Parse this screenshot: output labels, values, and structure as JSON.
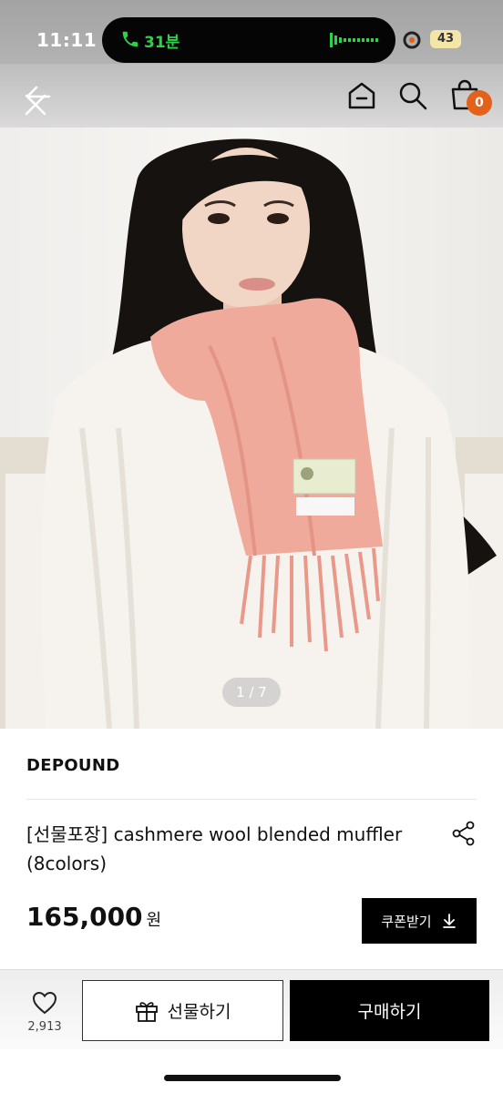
{
  "status_bar": {
    "time": "11:11",
    "call_duration": "31분",
    "battery": "43"
  },
  "nav": {
    "cart_count": "0",
    "icons": [
      "back-arrow-icon",
      "close-icon",
      "home-icon",
      "search-icon",
      "shopping-bag-icon"
    ]
  },
  "gallery": {
    "pager": "1 / 7",
    "current": 1,
    "total": 7
  },
  "product": {
    "brand": "DEPOUND",
    "title": "[선물포장] cashmere wool blended muffler (8colors)",
    "price": "165,000",
    "price_unit": "원",
    "coupon_label": "쿠폰받기"
  },
  "bottom_bar": {
    "like_count": "2,913",
    "gift_label": "선물하기",
    "buy_label": "구매하기"
  },
  "colors": {
    "accent": "#e2621b",
    "call_green": "#2fd14b",
    "primary_button": "#000000"
  }
}
